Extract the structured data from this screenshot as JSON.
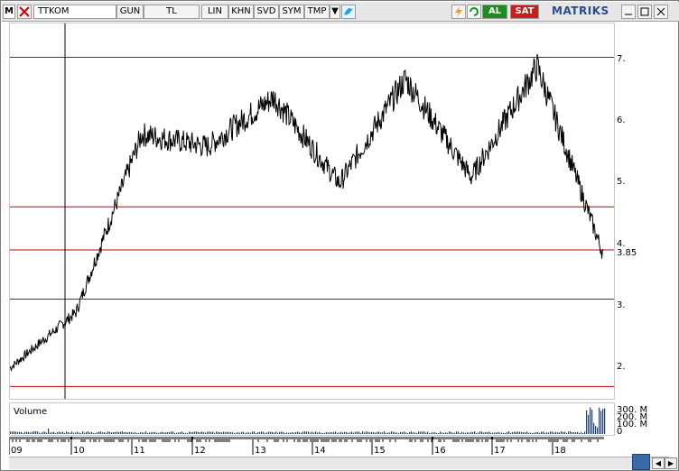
{
  "toolbar": {
    "m_label": "M",
    "symbol": "TTKOM",
    "period": "GUN",
    "currency": "TL",
    "scale": "LIN",
    "b1": "KHN",
    "b2": "SVD",
    "b3": "SYM",
    "b4": "TMP",
    "buy": "AL",
    "sell": "SAT",
    "brand": "MATRIKS"
  },
  "price_axis": {
    "ticks": [
      "7.",
      "6.",
      "5.",
      "4.",
      "3.85",
      "3.",
      "2."
    ],
    "last_value": "3.85"
  },
  "volume_panel": {
    "label": "Volume",
    "ticks": [
      "300. M",
      "200. M",
      "100. M",
      "0"
    ]
  },
  "x_axis": {
    "labels": [
      "09",
      "10",
      "11",
      "12",
      "13",
      "14",
      "15",
      "16",
      "17",
      "18"
    ]
  },
  "colors": {
    "hline": "#c80000",
    "price": "#000000",
    "volume": "#1f3f7a"
  },
  "chart_data": {
    "type": "line",
    "x": [
      "09",
      "10",
      "11",
      "12",
      "13",
      "14",
      "15",
      "16",
      "17",
      "18"
    ],
    "series": [
      {
        "values": [
          2.0,
          2.9,
          5.8,
          5.6,
          6.4,
          5.0,
          6.7,
          5.1,
          6.9,
          3.85
        ]
      }
    ],
    "hlines": [
      7.05,
      4.62,
      3.92,
      3.12,
      1.7
    ],
    "ylim": [
      1.5,
      7.6
    ]
  }
}
